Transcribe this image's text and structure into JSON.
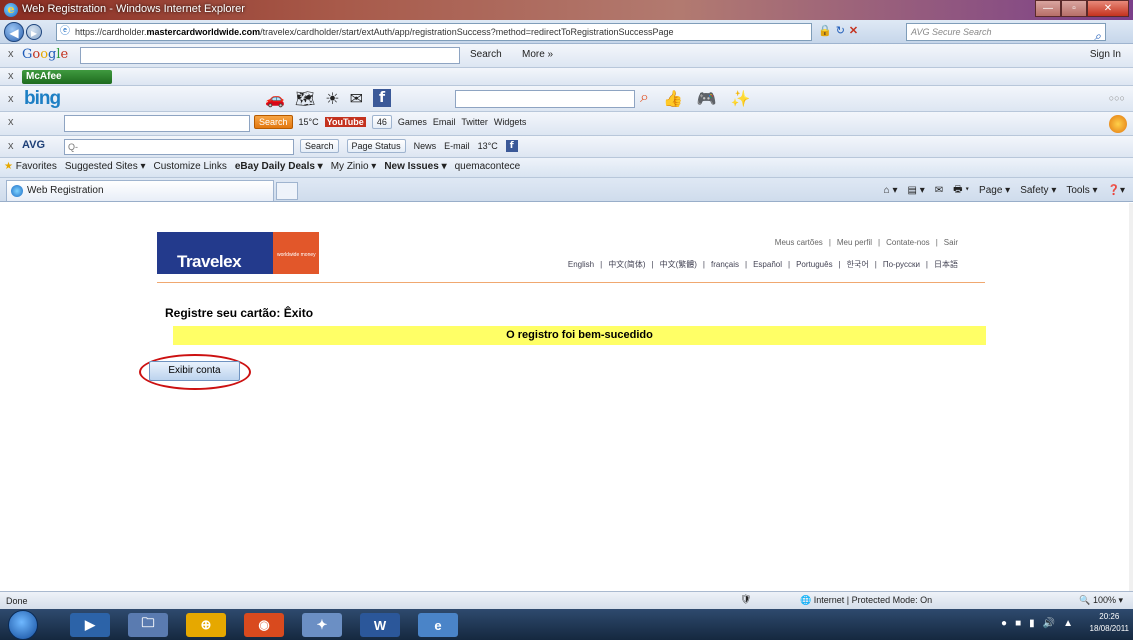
{
  "window": {
    "title": "Web Registration - Windows Internet Explorer",
    "url_prefix": "https://cardholder.",
    "url_domain": "mastercardworldwide.com",
    "url_path": "/travelex/cardholder/start/extAuth/app/registrationSuccess?method=redirectToRegistrationSuccessPage",
    "search_placeholder": "AVG Secure Search"
  },
  "toolbars": {
    "google": {
      "search_label": "Search",
      "more_label": "More »",
      "signin_label": "Sign In"
    },
    "mcafee": {
      "label": "McAfee"
    },
    "bing": {
      "logo": "bing"
    },
    "tb4": {
      "search_label": "Search",
      "weather": "15°C",
      "youtube": "YouTube",
      "counter": "46",
      "games": "Games",
      "email": "Email",
      "twitter": "Twitter",
      "widgets": "Widgets"
    },
    "avg": {
      "logo": "AVG",
      "search_btn": "Search",
      "page_status": "Page Status",
      "news": "News",
      "email": "E-mail",
      "temp": "13°C"
    }
  },
  "favorites": {
    "label": "Favorites",
    "items": [
      "Suggested Sites ▾",
      "Customize Links",
      "eBay Daily Deals ▾",
      "My Zinio ▾",
      "New Issues ▾",
      "quemacontece"
    ]
  },
  "tab": {
    "label": "Web Registration"
  },
  "commandbar": [
    "Page ▾",
    "Safety ▾",
    "Tools ▾"
  ],
  "page": {
    "logo_main": "Travelex",
    "logo_sub": "worldwide money",
    "toplinks": [
      "Meus cartões",
      "|",
      "Meu perfil",
      "|",
      "Contate-nos",
      "|",
      "Sair"
    ],
    "languages": [
      "English",
      "|",
      "中文(简体)",
      "|",
      "中文(繁體)",
      "|",
      "français",
      "|",
      "Español",
      "|",
      "Português",
      "|",
      "한국어",
      "|",
      "По-русски",
      "|",
      "日本語"
    ],
    "heading": "Registre seu cartão: Êxito",
    "success_message": "O registro foi bem-sucedido",
    "view_account_button": "Exibir conta"
  },
  "statusbar": {
    "done": "Done",
    "zone": "Internet | Protected Mode: On",
    "zoom": "100%"
  },
  "taskbar": {
    "time": "20:26",
    "date": "18/08/2011"
  },
  "colors": {
    "travelex_blue": "#233a8c",
    "travelex_orange": "#e2572a",
    "success_yellow": "#ffff66",
    "annotation_red": "#cc1111"
  }
}
